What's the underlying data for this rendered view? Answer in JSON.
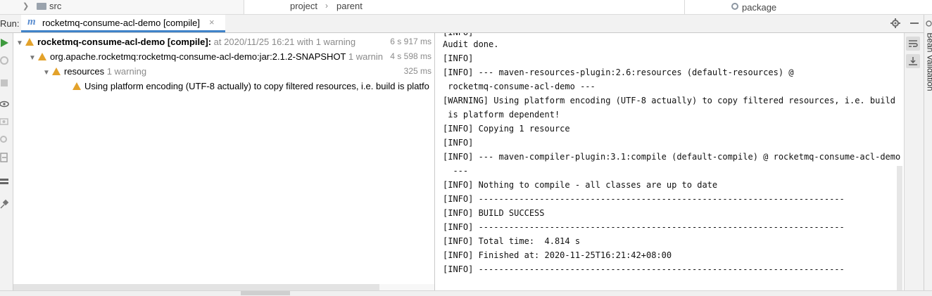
{
  "topbar": {
    "folder_label": "src",
    "breadcrumb": [
      "project",
      "parent"
    ],
    "right_item": "package"
  },
  "runbar": {
    "label": "Run:",
    "tab_title": "rocketmq-consume-acl-demo [compile]",
    "close_glyph": "×"
  },
  "tree": {
    "rows": [
      {
        "title": "rocketmq-consume-acl-demo [compile]:",
        "detail": "at 2020/11/25 16:21 with 1 warning",
        "time": "6 s 917 ms"
      },
      {
        "title": "org.apache.rocketmq:rocketmq-consume-acl-demo:jar:2.1.2-SNAPSHOT",
        "detail": "1 warnin",
        "time": "4 s 598 ms"
      },
      {
        "title": "resources",
        "detail": "1 warning",
        "time": "325 ms"
      },
      {
        "title": "Using platform encoding (UTF-8 actually) to copy filtered resources, i.e. build is platfo",
        "detail": "",
        "time": ""
      }
    ]
  },
  "console": {
    "lines": [
      "[INFO] ---------",
      "Audit done.",
      "[INFO]",
      "[INFO] --- maven-resources-plugin:2.6:resources (default-resources) @",
      " rocketmq-consume-acl-demo ---",
      "[WARNING] Using platform encoding (UTF-8 actually) to copy filtered resources, i.e. build",
      " is platform dependent!",
      "[INFO] Copying 1 resource",
      "[INFO]",
      "[INFO] --- maven-compiler-plugin:3.1:compile (default-compile) @ rocketmq-consume-acl-demo",
      "  ---",
      "[INFO] Nothing to compile - all classes are up to date",
      "[INFO] ------------------------------------------------------------------------",
      "[INFO] BUILD SUCCESS",
      "[INFO] ------------------------------------------------------------------------",
      "[INFO] Total time:  4.814 s",
      "[INFO] Finished at: 2020-11-25T16:21:42+08:00",
      "[INFO] ------------------------------------------------------------------------"
    ]
  },
  "sidepanel": {
    "label": "Bean Validation"
  },
  "colors": {
    "accent": "#4083c9",
    "warning": "#e3a22b",
    "run_green": "#3e9a3e"
  }
}
